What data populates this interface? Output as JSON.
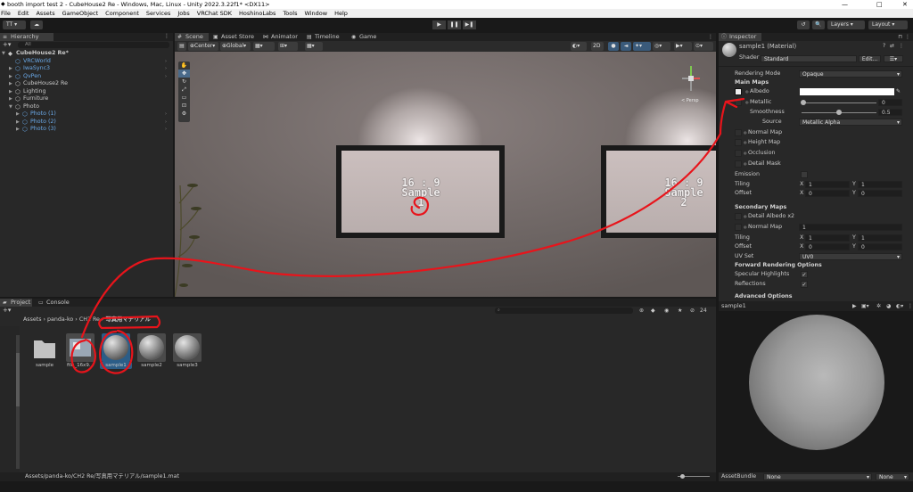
{
  "window": {
    "title": "booth import test 2 - CubeHouse2 Re - Windows, Mac, Linux - Unity 2022.3.22f1* <DX11>",
    "controls": [
      "—",
      "□",
      "✕"
    ]
  },
  "menubar": [
    "File",
    "Edit",
    "Assets",
    "GameObject",
    "Component",
    "Services",
    "Jobs",
    "VRChat SDK",
    "HoshinoLabs",
    "Tools",
    "Window",
    "Help"
  ],
  "toolbar": {
    "account": "TT ▾",
    "cloud": "☁",
    "play": "▶",
    "pause": "❚❚",
    "step": "▶❚",
    "history": "↺",
    "search": "🔍",
    "layers": "Layers",
    "layout": "Layout"
  },
  "hierarchy": {
    "tab": "Hierarchy",
    "search_placeholder": "All",
    "items": [
      {
        "label": "CubeHouse2 Re*",
        "indent": 0,
        "bold": true,
        "blue": false,
        "arrow": "▼"
      },
      {
        "label": "VRCWorld",
        "indent": 1,
        "bold": false,
        "blue": true,
        "arrow": ""
      },
      {
        "label": "IwaSync3",
        "indent": 1,
        "bold": false,
        "blue": true,
        "arrow": "▶"
      },
      {
        "label": "QvPen",
        "indent": 1,
        "bold": false,
        "blue": true,
        "arrow": "▶"
      },
      {
        "label": "CubeHouse2 Re",
        "indent": 1,
        "bold": false,
        "blue": false,
        "arrow": "▶"
      },
      {
        "label": "Lighting",
        "indent": 1,
        "bold": false,
        "blue": false,
        "arrow": "▶"
      },
      {
        "label": "Furniture",
        "indent": 1,
        "bold": false,
        "blue": false,
        "arrow": "▶"
      },
      {
        "label": "Photo",
        "indent": 1,
        "bold": false,
        "blue": false,
        "arrow": "▼"
      },
      {
        "label": "Photo (1)",
        "indent": 2,
        "bold": false,
        "blue": true,
        "arrow": "▶"
      },
      {
        "label": "Photo (2)",
        "indent": 2,
        "bold": false,
        "blue": true,
        "arrow": "▶"
      },
      {
        "label": "Photo (3)",
        "indent": 2,
        "bold": false,
        "blue": true,
        "arrow": "▶"
      }
    ]
  },
  "scene_tabs": [
    "Scene",
    "Asset Store",
    "Animator",
    "Timeline",
    "Game"
  ],
  "scene_toolbar": {
    "pivot": "Center",
    "space": "Global",
    "mode_2d": "2D"
  },
  "scene": {
    "frame1": {
      "line1": "16 : 9",
      "line2": "Sample",
      "line3": "1"
    },
    "frame2": {
      "line1": "16 : 9",
      "line2": "Sample",
      "line3": "2"
    },
    "persp": "< Persp"
  },
  "project": {
    "tabs": [
      "Project",
      "Console"
    ],
    "breadcrumb": [
      "Assets",
      "panda-ko",
      "CH2 Re",
      "写真用マテリアル"
    ],
    "visible_count": "24",
    "assets": [
      "sample",
      "file_16x9...",
      "sample1",
      "sample2",
      "sample3"
    ],
    "path": "Assets/panda-ko/CH2 Re/写真用マテリアル/sample1.mat"
  },
  "inspector": {
    "tab": "Inspector",
    "title": "sample1 (Material)",
    "shader_label": "Shader",
    "shader": "Standard",
    "edit_button": "Edit...",
    "rendering_mode_label": "Rendering Mode",
    "rendering_mode": "Opaque",
    "main_maps": "Main Maps",
    "albedo": "Albedo",
    "metallic": "Metallic",
    "metallic_value": 0,
    "smoothness": "Smoothness",
    "smoothness_value": 0.5,
    "source_label": "Source",
    "source": "Metallic Alpha",
    "normal_map": "Normal Map",
    "height_map": "Height Map",
    "occlusion": "Occlusion",
    "detail_mask": "Detail Mask",
    "emission": "Emission",
    "tiling": "Tiling",
    "offset": "Offset",
    "x": "X",
    "y": "Y",
    "tiling_x": "1",
    "tiling_y": "1",
    "offset_x": "0",
    "offset_y": "0",
    "secondary_maps": "Secondary Maps",
    "detail_albedo": "Detail Albedo x2",
    "sec_normal_map": "Normal Map",
    "sec_normal_value": "1",
    "sec_tiling_x": "1",
    "sec_tiling_y": "1",
    "sec_offset_x": "0",
    "sec_offset_y": "0",
    "uv_set_label": "UV Set",
    "uv_set": "UV0",
    "forward_options": "Forward Rendering Options",
    "specular_highlights": "Specular Highlights",
    "reflections": "Reflections",
    "advanced_options": "Advanced Options",
    "preview_name": "sample1",
    "assetbundle_label": "AssetBundle",
    "assetbundle": "None",
    "assetbundle_variant": "None"
  },
  "colors": {
    "annotation": "#e8141b",
    "selection": "#2c5d87",
    "link_blue": "#6aa9e8"
  }
}
